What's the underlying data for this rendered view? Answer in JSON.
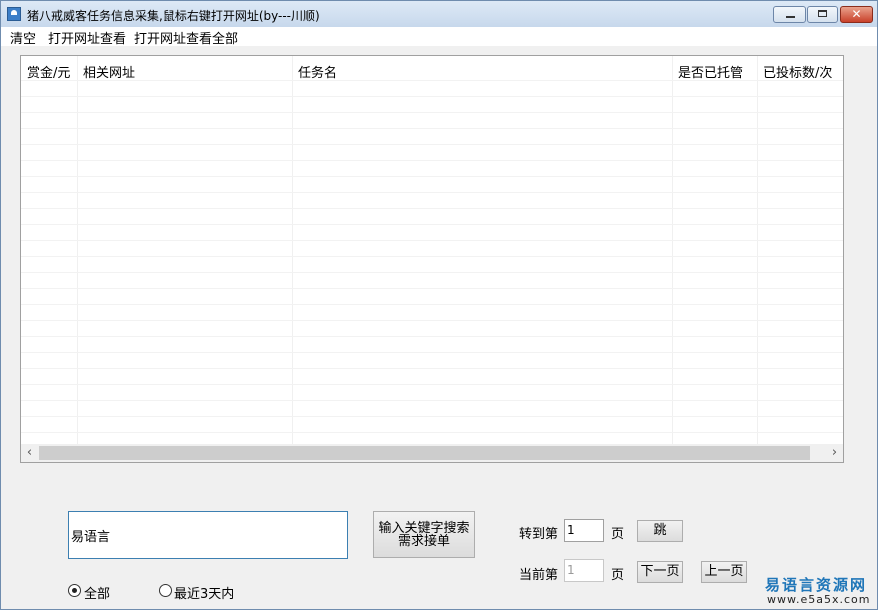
{
  "window": {
    "title": "猪八戒威客任务信息采集,鼠标右键打开网址(by---川顺)"
  },
  "menu": {
    "items": [
      "清空",
      "打开网址查看",
      "打开网址查看全部"
    ]
  },
  "table": {
    "columns": [
      "赏金/元",
      "相关网址",
      "任务名",
      "是否已托管",
      "已投标数/次"
    ]
  },
  "search": {
    "value": "易语言",
    "button_label": "输入关键字搜索需求接单"
  },
  "pagination": {
    "goto_label": "转到第",
    "goto_value": "1",
    "page_unit": "页",
    "jump_label": "跳",
    "current_label": "当前第",
    "current_value": "1",
    "next_label": "下一页",
    "prev_label": "上一页"
  },
  "filter": {
    "all_label": "全部",
    "recent_label": "最近3天内",
    "selected": "all"
  },
  "watermark": {
    "title": "易语言资源网",
    "url": "www.e5a5x.com"
  }
}
